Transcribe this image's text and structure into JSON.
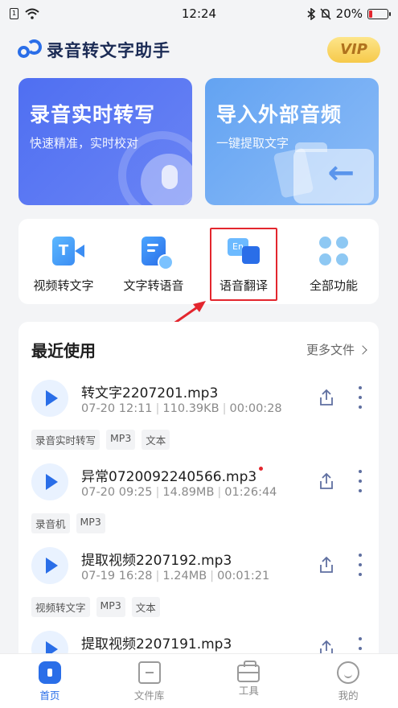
{
  "status_bar": {
    "time": "12:24",
    "battery": "20%",
    "battery_level": 0.2,
    "battery_color": "#e3262e"
  },
  "header": {
    "title": "录音转文字助手",
    "vip": "VIP"
  },
  "hero": {
    "left": {
      "title": "录音实时转写",
      "subtitle": "快速精准，实时校对"
    },
    "right": {
      "title": "导入外部音频",
      "subtitle": "一键提取文字"
    }
  },
  "functions": [
    {
      "label": "视频转文字",
      "icon": "video-to-text-icon"
    },
    {
      "label": "文字转语音",
      "icon": "text-to-speech-icon"
    },
    {
      "label": "语音翻译",
      "icon": "voice-translate-icon",
      "icon_text": "En"
    },
    {
      "label": "全部功能",
      "icon": "all-functions-icon"
    }
  ],
  "recent": {
    "title": "最近使用",
    "more": "更多文件",
    "files": [
      {
        "name": "转文字2207201.mp3",
        "date": "07-20 12:11",
        "size": "110.39KB",
        "duration": "00:00:28",
        "new": false,
        "tags": [
          "录音实时转写",
          "MP3",
          "文本"
        ]
      },
      {
        "name": "异常0720092240566.mp3",
        "date": "07-20 09:25",
        "size": "14.89MB",
        "duration": "01:26:44",
        "new": true,
        "tags": [
          "录音机",
          "MP3"
        ]
      },
      {
        "name": "提取视频2207192.mp3",
        "date": "07-19 16:28",
        "size": "1.24MB",
        "duration": "00:01:21",
        "new": false,
        "tags": [
          "视频转文字",
          "MP3",
          "文本"
        ]
      },
      {
        "name": "提取视频2207191.mp3",
        "date": "",
        "size": "",
        "duration": "",
        "new": false,
        "tags": []
      }
    ]
  },
  "nav": [
    {
      "label": "首页",
      "active": true
    },
    {
      "label": "文件库",
      "active": false
    },
    {
      "label": "工具",
      "active": false
    },
    {
      "label": "我的",
      "active": false
    }
  ],
  "colors": {
    "accent": "#2a6ee8",
    "highlight": "#e3262e"
  }
}
